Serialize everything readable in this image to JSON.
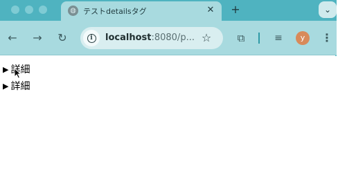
{
  "tab": {
    "title": "テストdetailsタグ",
    "close_glyph": "✕",
    "favicon": "globe-icon"
  },
  "new_tab_glyph": "+",
  "tab_menu_glyph": "⌄",
  "toolbar": {
    "back_glyph": "←",
    "forward_glyph": "→",
    "reload_glyph": "↻",
    "url_host": "localhost",
    "url_rest": ":8080/p...",
    "bookmark_glyph": "☆",
    "extensions_glyph": "⧉",
    "media_glyph": "≡",
    "avatar_letter": "y",
    "menu_glyph": "⋮"
  },
  "page": {
    "details": [
      {
        "marker": "▶",
        "summary": "詳細"
      },
      {
        "marker": "▶",
        "summary": "詳細"
      }
    ]
  },
  "colors": {
    "tabstrip": "#4fb3c0",
    "toolbar": "#a8dadf",
    "avatar": "#d88a5a"
  }
}
